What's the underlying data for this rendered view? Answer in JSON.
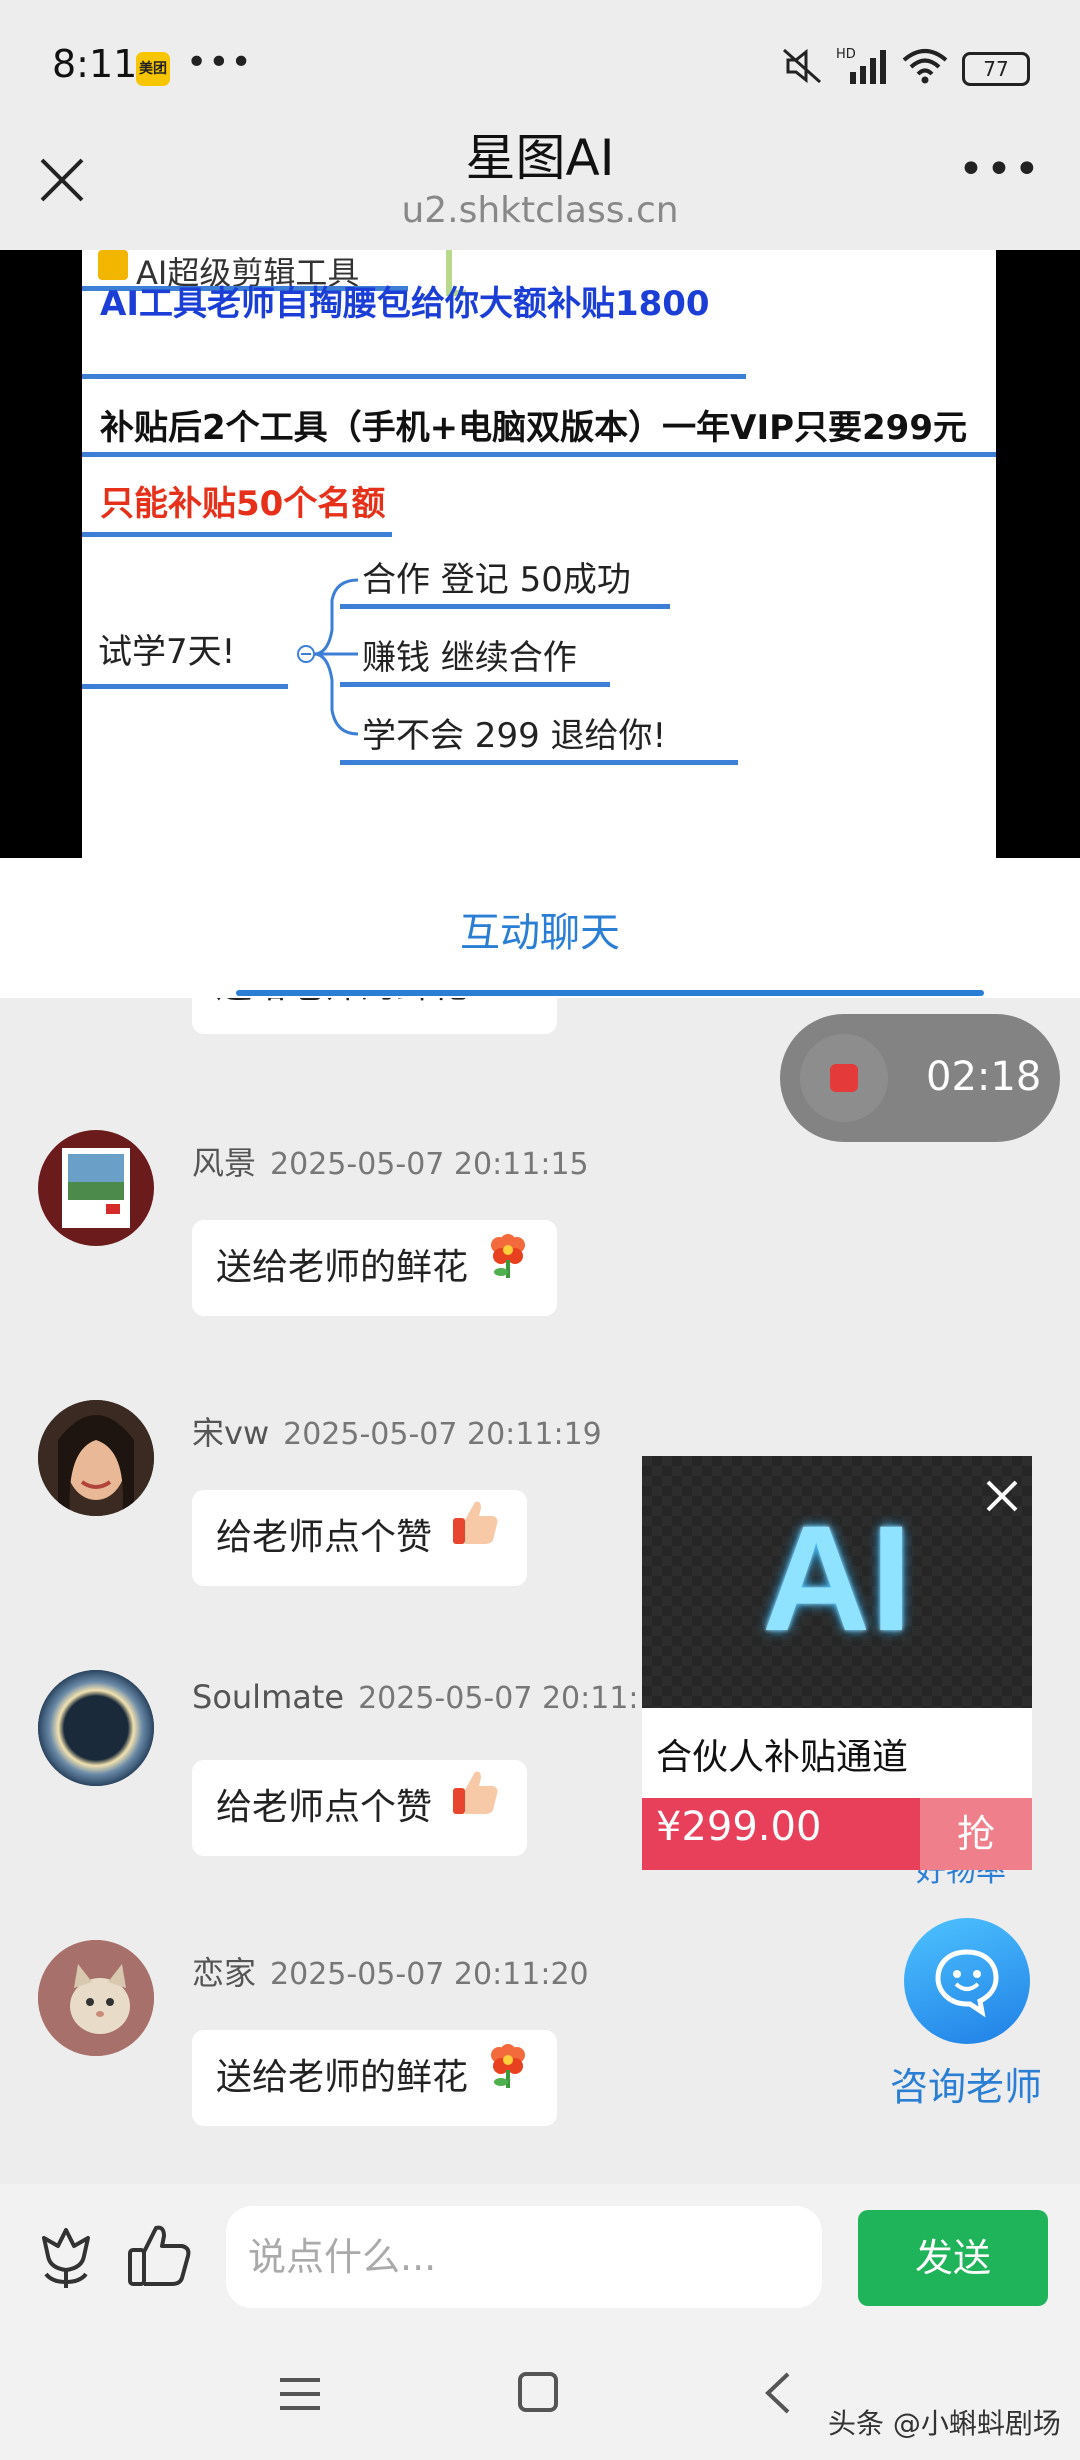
{
  "status_bar": {
    "time": "8:11",
    "app_badge": "美团",
    "more": "•••",
    "signal_label": "HD",
    "battery": "77"
  },
  "header": {
    "title": "星图AI",
    "url": "u2.shktclass.cn",
    "more": "•••"
  },
  "slide": {
    "top_label": "AI超级剪辑工具",
    "line1": "AI工具老师自掏腰包给你大额补贴1800",
    "line2": "补贴后2个工具（手机+电脑双版本）一年VIP只要299元",
    "line3": "只能补贴50个名额",
    "root": "试学7天!",
    "branches": [
      "合作 登记  50成功",
      "赚钱 继续合作",
      "学不会  299  退给你!"
    ]
  },
  "tabs": {
    "chat": "互动聊天"
  },
  "recording": {
    "time": "02:18"
  },
  "messages": [
    {
      "user": "",
      "time": "",
      "text": "送给老师的鲜花",
      "emoji": "flower"
    },
    {
      "user": "风景",
      "time": "2025-05-07 20:11:15",
      "text": "送给老师的鲜花",
      "emoji": "flower"
    },
    {
      "user": "宋vw",
      "time": "2025-05-07 20:11:19",
      "text": "给老师点个赞",
      "emoji": "thumbs-up"
    },
    {
      "user": "Soulmate",
      "time": "2025-05-07 20:11:",
      "text": "给老师点个赞",
      "emoji": "thumbs-up"
    },
    {
      "user": "恋家",
      "time": "2025-05-07 20:11:20",
      "text": "送给老师的鲜花",
      "emoji": "flower"
    }
  ],
  "product": {
    "image_text": "AI",
    "name": "合伙人补贴通道",
    "price": "¥299.00",
    "grab": "抢",
    "behind_text": "好物率"
  },
  "consult": {
    "label": "咨询老师"
  },
  "input": {
    "placeholder": "说点什么...",
    "send": "发送"
  },
  "watermark": "头条 @小蝌蚪剧场",
  "colors": {
    "accent": "#2a7fd4",
    "send": "#1fb35a",
    "price": "#e8405a"
  }
}
